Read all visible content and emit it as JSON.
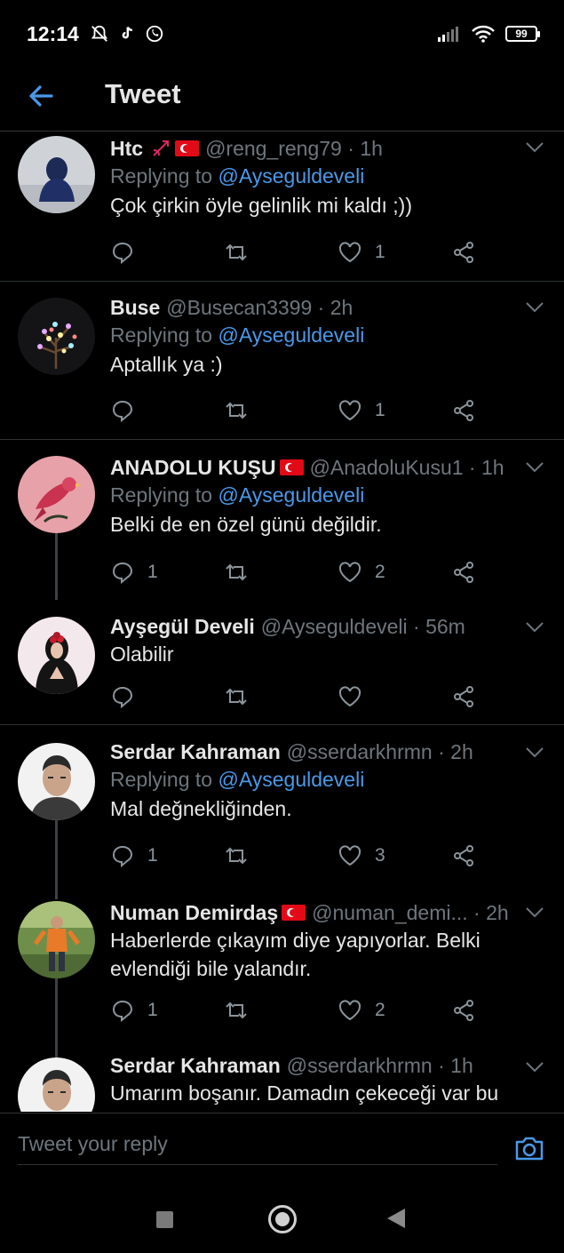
{
  "status": {
    "time": "12:14",
    "battery": "99"
  },
  "header": {
    "title": "Tweet"
  },
  "tweets": [
    {
      "name": "Htc",
      "handle": "@reng_reng79",
      "time": "1h",
      "reply_prefix": "Replying to",
      "reply_to": "@Ayseguldeveli",
      "text": "Çok çirkin öyle gelinlik mi kaldı ;))",
      "replies": "",
      "likes": "1"
    },
    {
      "name": "Buse",
      "handle": "@Busecan3399",
      "time": "2h",
      "reply_prefix": "Replying to",
      "reply_to": "@Ayseguldeveli",
      "text": "Aptallık ya :)",
      "replies": "",
      "likes": "1"
    },
    {
      "name": "ANADOLU KUŞU",
      "handle": "@AnadoluKusu1",
      "time": "1h",
      "reply_prefix": "Replying to",
      "reply_to": "@Ayseguldeveli",
      "text": "Belki de en özel günü değildir.",
      "replies": "1",
      "likes": "2"
    },
    {
      "name": "Ayşegül Develi",
      "handle": "@Ayseguldeveli",
      "time": "56m",
      "text": "Olabilir",
      "replies": "",
      "likes": ""
    },
    {
      "name": "Serdar Kahraman",
      "handle": "@sserdarkhrmn",
      "time": "2h",
      "reply_prefix": "Replying to",
      "reply_to": "@Ayseguldeveli",
      "text": "Mal değnekliğinden.",
      "replies": "1",
      "likes": "3"
    },
    {
      "name": "Numan Demirdaş",
      "handle": "@numan_demi...",
      "time": "2h",
      "text_line1": "Haberlerde çıkayım diye yapıyorlar. Belki",
      "text_line2": "evlendiği bile yalandır.",
      "replies": "1",
      "likes": "2"
    },
    {
      "name": "Serdar Kahraman",
      "handle": "@sserdarkhrmn",
      "time": "1h",
      "text": "Umarım boşanır. Damadın çekeceği var bu"
    }
  ],
  "reply_bar": {
    "placeholder": "Tweet your reply"
  },
  "colors": {
    "accent": "#4a99e9",
    "muted": "#6e767d",
    "text": "#e6e6e6",
    "background": "#000000"
  }
}
